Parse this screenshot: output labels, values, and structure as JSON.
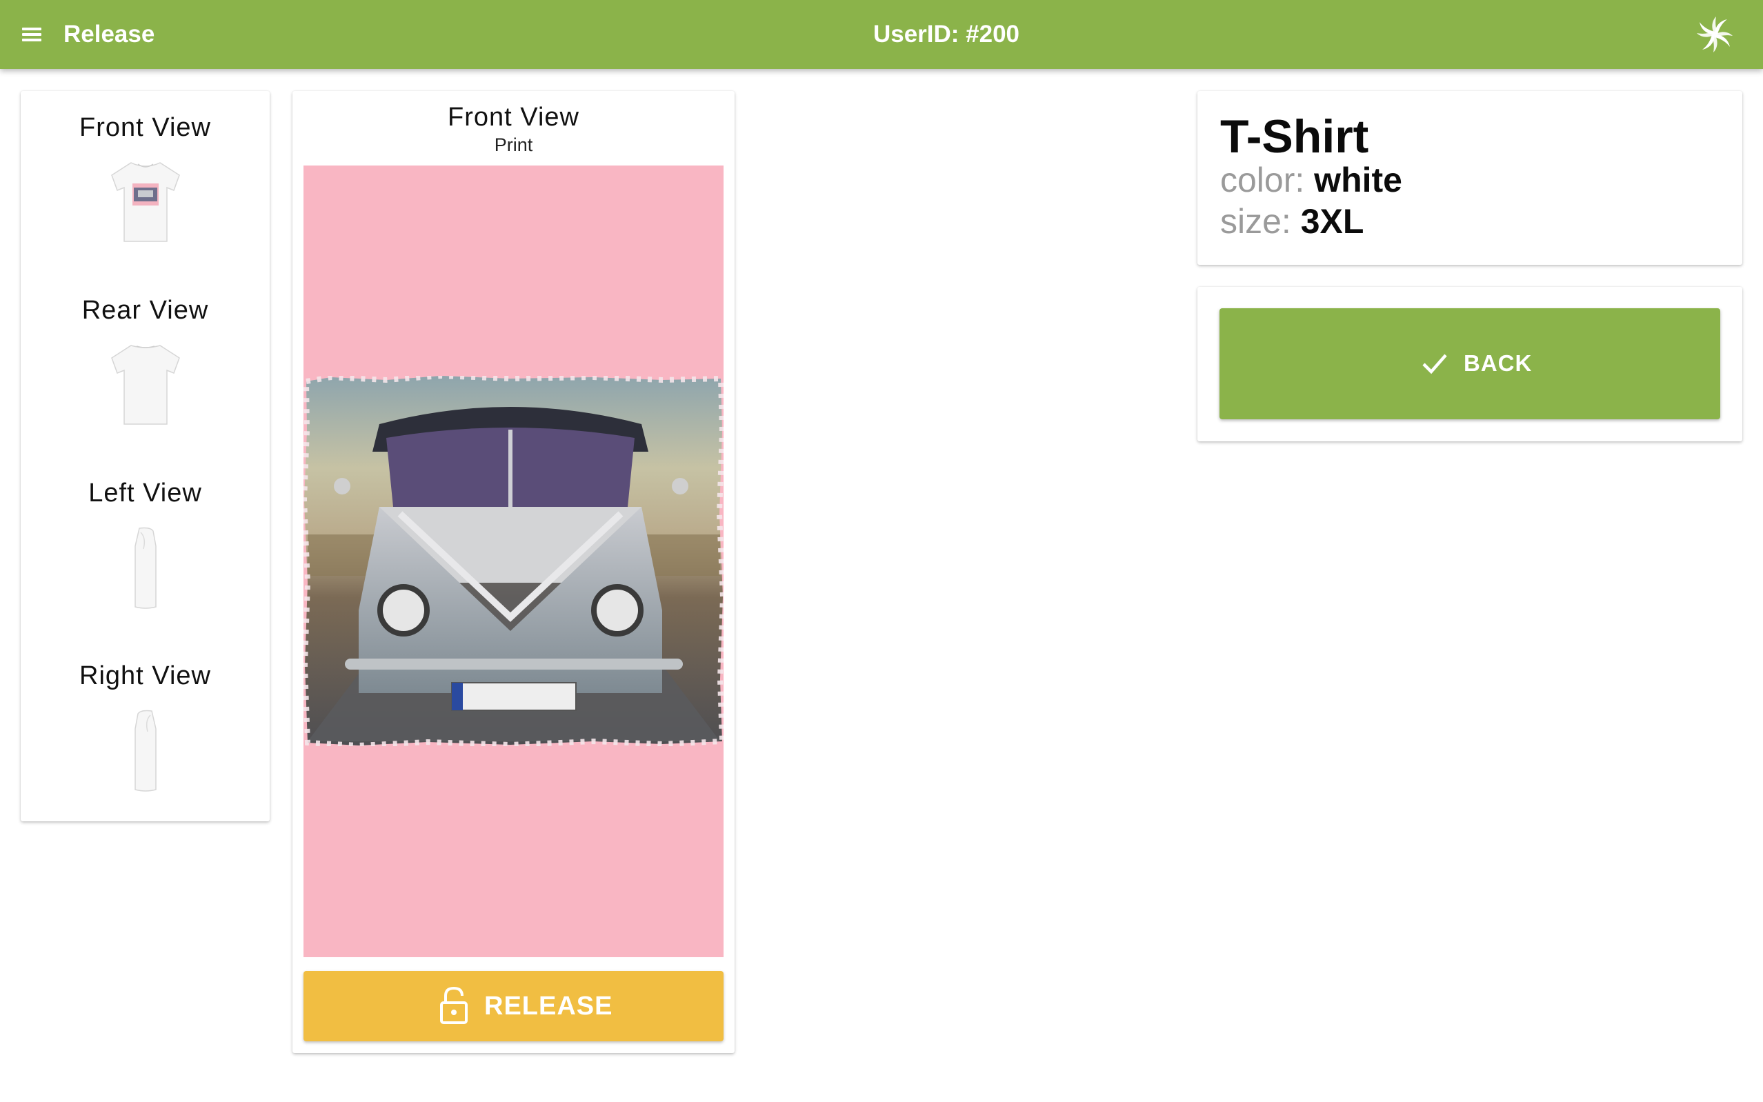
{
  "colors": {
    "brand": "#8bb34a",
    "release": "#f1be42",
    "print_background": "#f9b6c3"
  },
  "topbar": {
    "menu_icon": "hamburger-menu-icon",
    "title": "Release",
    "user_id": "UserID: #200",
    "logo_icon": "swirl-logo-icon"
  },
  "views": [
    {
      "label": "Front View",
      "icon": "tshirt-front-icon"
    },
    {
      "label": "Rear View",
      "icon": "tshirt-rear-icon"
    },
    {
      "label": "Left View",
      "icon": "tshirt-left-icon"
    },
    {
      "label": "Right View",
      "icon": "tshirt-right-icon"
    }
  ],
  "preview": {
    "title": "Front View",
    "subtitle": "Print",
    "release_label": "RELEASE",
    "release_icon": "lock-open-icon"
  },
  "product": {
    "name": "T-Shirt",
    "color_key": "color:",
    "color_value": "white",
    "size_key": "size:",
    "size_value": "3XL"
  },
  "actions": {
    "back_label": "BACK",
    "back_icon": "check-icon"
  }
}
